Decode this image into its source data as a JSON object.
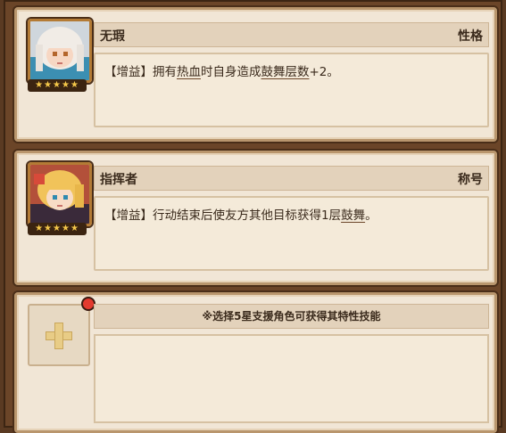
{
  "cards": [
    {
      "name": "无瑕",
      "tag": "性格",
      "stars": "★★★★★",
      "desc_prefix": "【增益】拥有",
      "desc_u1": "热血",
      "desc_mid": "时自身造成",
      "desc_u2": "鼓舞层数",
      "desc_suffix": "+2。"
    },
    {
      "name": "指挥者",
      "tag": "称号",
      "stars": "★★★★★",
      "desc_prefix": "【增益】行动结束后使友方其他目标获得1层",
      "desc_u1": "鼓舞",
      "desc_suffix": "。"
    }
  ],
  "support_slot": {
    "hint": "※选择5星支援角色可获得其特性技能"
  },
  "colors": {
    "card_bg": "#f1e6d6",
    "frame": "#6b4528",
    "star": "#f5c84a",
    "alert": "#e33a2f"
  }
}
